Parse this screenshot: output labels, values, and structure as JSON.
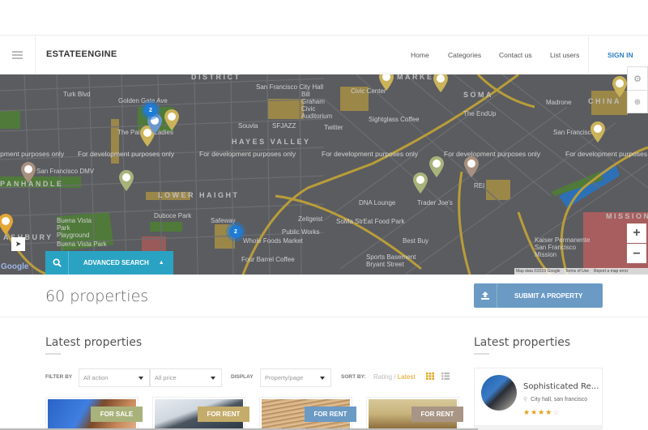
{
  "header": {
    "logo": "ESTATEENGINE",
    "nav": [
      "Home",
      "Categories",
      "Contact us",
      "List users"
    ],
    "signin": "SIGN IN",
    "menu_icon": "hamburger-icon"
  },
  "map": {
    "district_labels": [
      "DISTRICT",
      "HAYES VALLEY",
      "PANHANDLE",
      "LOWER HAIGHT",
      "SOMA",
      "MARKET",
      "CHINA",
      "MISSION",
      "ASHBURY"
    ],
    "place_labels": [
      "Turk Blvd",
      "Golden Gate Ave",
      "The Painted Ladies",
      "San Francisco DMV",
      "Buena Vista Park",
      "Buena Vista Park Playground",
      "Duboce Park",
      "Safeway",
      "Whole Foods Market",
      "Public Works",
      "Four Barrel Coffee",
      "San Francisco City Hall",
      "Bill Graham Civic Auditorium",
      "Souvla",
      "SFJAZZ",
      "Twitter",
      "Civic Center",
      "Sightglass Coffee",
      "The EndUp",
      "Madrone",
      "San Francisco",
      "REI",
      "Trader Joe's",
      "DNA Lounge",
      "SoMa StrEat Food Park",
      "Best Buy",
      "Sports Basement Bryant Street",
      "Kaiser Permanente San Francisco Mission",
      "Zeitgeist"
    ],
    "watermark": "For development purposes only",
    "cluster_counts": [
      "2",
      "2"
    ],
    "google": "Google",
    "attribution": [
      "Map data ©2019 Google",
      "Terms of Use",
      "Report a map error"
    ],
    "zoom_in": "+",
    "zoom_out": "−"
  },
  "advanced_search": {
    "label": "ADVANCED SEARCH",
    "icon": "search-icon"
  },
  "summary": {
    "count": "60 properties",
    "submit_label": "SUBMIT A PROPERTY",
    "submit_icon": "upload-icon"
  },
  "main": {
    "heading": "Latest properties",
    "filter_label": "FILTER BY",
    "action_select": "All action",
    "price_select": "All price",
    "display_label": "DISPLAY",
    "display_select": "Property/page",
    "sort_label": "SORT BY:",
    "sort_rating": "Rating",
    "sort_sep": " / ",
    "sort_latest": "Latest",
    "cards": [
      {
        "badge": "FOR SALE",
        "color": "#a9b27a"
      },
      {
        "badge": "FOR RENT",
        "color": "#c4ac6a"
      },
      {
        "badge": "FOR RENT",
        "color": "#6b9ac4"
      },
      {
        "badge": "FOR RENT",
        "color": "#a99585"
      }
    ]
  },
  "sidebar": {
    "heading": "Latest properties",
    "item": {
      "title": "Sophisticated Re...",
      "location": "City hall, san francisco",
      "rating": 4,
      "rating_max": 5
    }
  },
  "colors": {
    "accent_teal": "#2aa3c3",
    "accent_blue": "#6b9ac4",
    "signin_blue": "#2f7fc1",
    "sort_active": "#e0a31f"
  }
}
